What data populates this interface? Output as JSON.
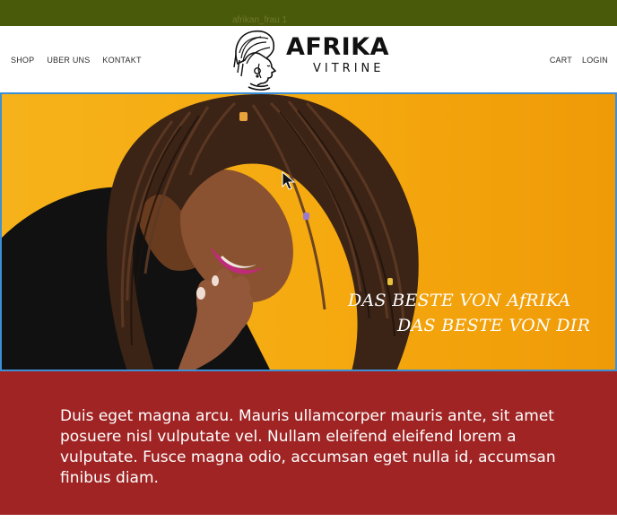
{
  "topbar": {
    "image_alt": "afrikan_frau 1"
  },
  "nav": {
    "left": [
      {
        "label": "SHOP"
      },
      {
        "label": "UBER UNS"
      },
      {
        "label": "KONTAKT"
      }
    ],
    "right": [
      {
        "label": "CART"
      },
      {
        "label": "LOGIN"
      }
    ]
  },
  "logo": {
    "title": "AFRIKA",
    "subtitle": "VITRINE",
    "icon": "woman-headwrap-icon"
  },
  "hero": {
    "line1": "DAS BESTE VON AfRIKA",
    "line2": "DAS BESTE VON DIR"
  },
  "band": {
    "text": "Duis eget magna arcu. Mauris ullamcorper mauris ante, sit amet posuere nisl vulputate vel. Nullam eleifend eleifend lorem a vulputate. Fusce magna odio, accumsan eget nulla id, accumsan finibus diam."
  },
  "colors": {
    "topbar": "#4a5a0b",
    "hero_bg": "#f6b21a",
    "band_bg": "#a02424",
    "divider": "#3d8fd6"
  }
}
